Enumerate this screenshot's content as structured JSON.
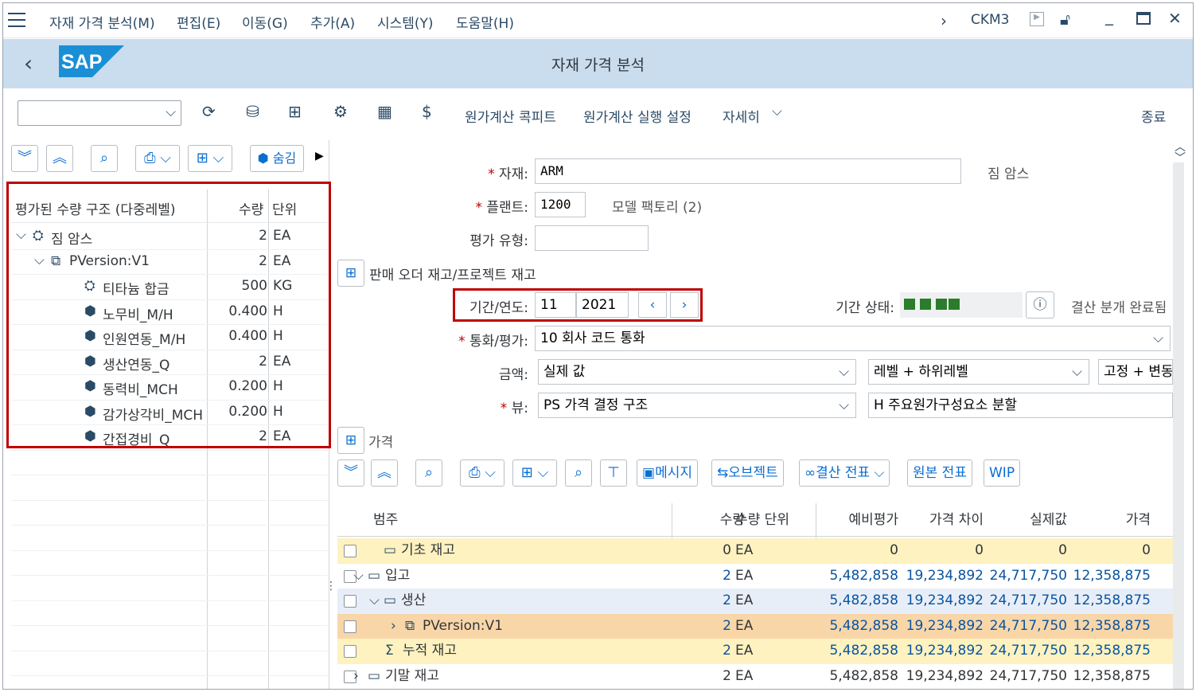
{
  "menubar": {
    "items": [
      "자재 가격 분석(M)",
      "편집(E)",
      "이동(G)",
      "추가(A)",
      "시스템(Y)",
      "도움말(H)"
    ],
    "tcode": "CKM3"
  },
  "title": "자재 가격 분석",
  "toolbar": {
    "buttons": [
      "원가계산 콕피트",
      "원가계산 실행 설정",
      "자세히",
      "종료"
    ]
  },
  "left": {
    "hide_label": "숨김",
    "columns": [
      "평가된 수량 구조 (다중레벨)",
      "수량",
      "단위"
    ],
    "rows": [
      {
        "name": "짐 암스",
        "qty": "2",
        "unit": "EA"
      },
      {
        "name": "PVersion:V1",
        "qty": "2",
        "unit": "EA"
      },
      {
        "name": "티타늄 합금",
        "qty": "500",
        "unit": "KG"
      },
      {
        "name": "노무비_M/H",
        "qty": "0.400",
        "unit": "H"
      },
      {
        "name": "인원연동_M/H",
        "qty": "0.400",
        "unit": "H"
      },
      {
        "name": "생산연동_Q",
        "qty": "2",
        "unit": "EA"
      },
      {
        "name": "동력비_MCH",
        "qty": "0.200",
        "unit": "H"
      },
      {
        "name": "감가상각비_MCH",
        "qty": "0.200",
        "unit": "H"
      },
      {
        "name": "간접경비_Q",
        "qty": "2",
        "unit": "EA"
      }
    ]
  },
  "form": {
    "material_label": "자재:",
    "material_value": "ARM",
    "material_desc": "짐 암스",
    "plant_label": "플랜트:",
    "plant_value": "1200",
    "plant_desc": "모델 팩토리 (2)",
    "valtype_label": "평가 유형:",
    "sales_stock_label": "판매 오더 재고/프로젝트 재고",
    "period_label": "기간/연도:",
    "period_value": "11",
    "year_value": "2021",
    "period_status_label": "기간 상태:",
    "status_text": "결산 분개 완료됨",
    "currency_label": "통화/평가:",
    "currency_value": "10 회사 코드 통화",
    "amount_label": "금액:",
    "amount_value": "실제 값",
    "level_value": "레벨 + 하위레벨",
    "fixvar_value": "고정 + 변동",
    "view_label": "뷰:",
    "view_value": "PS 가격 결정 구조",
    "split_value": "H 주요원가구성요소 분할",
    "price_label": "가격"
  },
  "grid_toolbar": [
    "메시지",
    "오브젝트",
    "결산 전표",
    "원본 전표",
    "WIP"
  ],
  "grid": {
    "columns": [
      "범주",
      "수량",
      "수량 단위",
      "예비평가",
      "가격 차이",
      "실제값",
      "가격"
    ],
    "rows": [
      {
        "cat": "기초 재고",
        "qty": "0",
        "unit": "EA",
        "prelim": "0",
        "diff": "0",
        "actual": "0",
        "price": "0"
      },
      {
        "cat": "입고",
        "qty": "2",
        "unit": "EA",
        "prelim": "5,482,858",
        "diff": "19,234,892",
        "actual": "24,717,750",
        "price": "12,358,875"
      },
      {
        "cat": "생산",
        "qty": "2",
        "unit": "EA",
        "prelim": "5,482,858",
        "diff": "19,234,892",
        "actual": "24,717,750",
        "price": "12,358,875"
      },
      {
        "cat": "PVersion:V1",
        "qty": "2",
        "unit": "EA",
        "prelim": "5,482,858",
        "diff": "19,234,892",
        "actual": "24,717,750",
        "price": "12,358,875"
      },
      {
        "cat": "누적 재고",
        "qty": "2",
        "unit": "EA",
        "prelim": "5,482,858",
        "diff": "19,234,892",
        "actual": "24,717,750",
        "price": "12,358,875"
      },
      {
        "cat": "기말 재고",
        "qty": "2",
        "unit": "EA",
        "prelim": "5,482,858",
        "diff": "19,234,892",
        "actual": "24,717,750",
        "price": "12,358,875"
      }
    ]
  }
}
